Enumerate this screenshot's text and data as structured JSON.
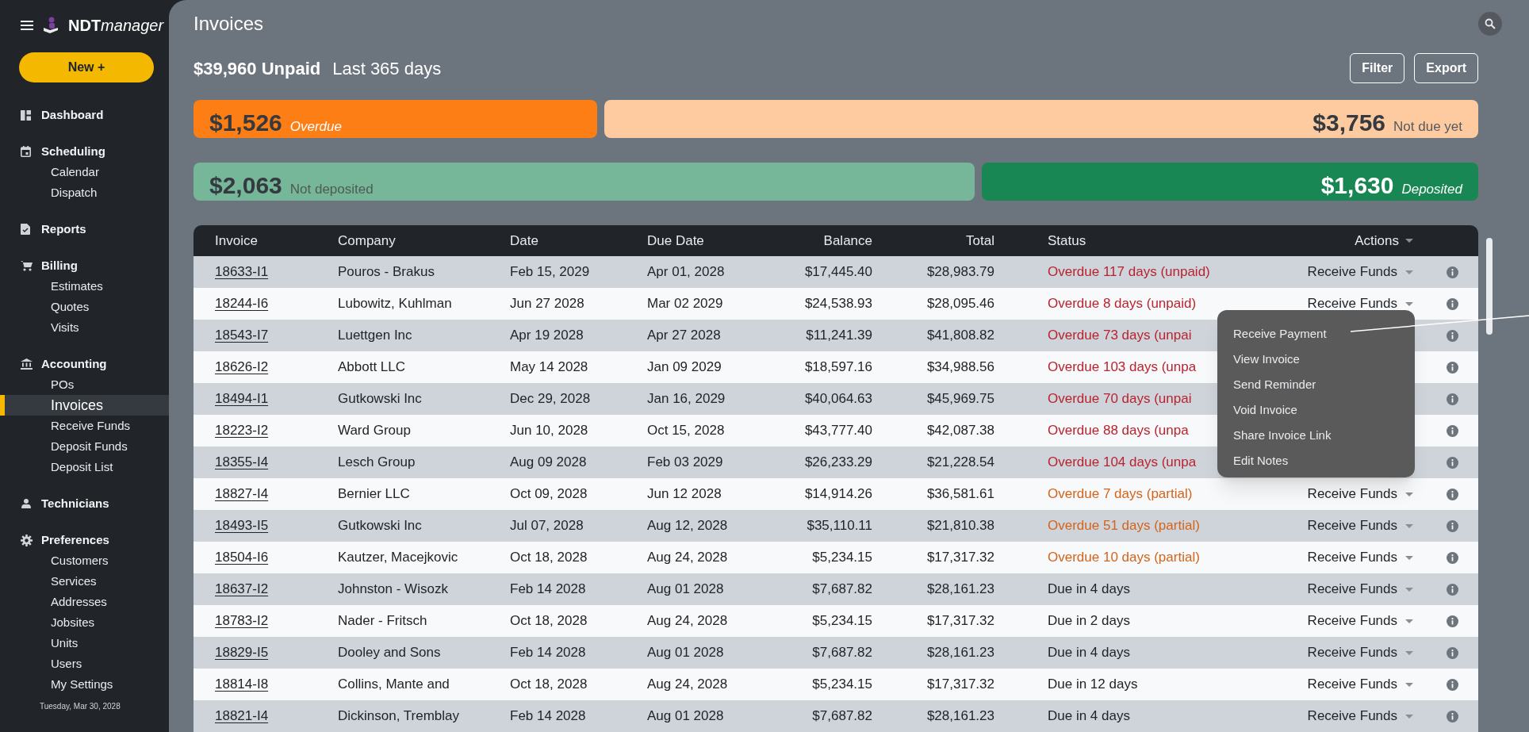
{
  "app": {
    "brand_bold": "NDT",
    "brand_rest": "manager",
    "new_button": "New +"
  },
  "sidebar": {
    "groups": [
      {
        "label": "Dashboard",
        "selected": false
      },
      {
        "label": "Scheduling",
        "selected": false,
        "children": [
          {
            "label": "Calendar",
            "selected": false
          },
          {
            "label": "Dispatch",
            "selected": false
          }
        ]
      },
      {
        "label": "Reports",
        "selected": false
      },
      {
        "label": "Billing",
        "selected": false,
        "children": [
          {
            "label": "Estimates",
            "selected": false
          },
          {
            "label": "Quotes",
            "selected": false
          },
          {
            "label": "Visits",
            "selected": false
          }
        ]
      },
      {
        "label": "Accounting",
        "selected": false,
        "children": [
          {
            "label": "POs",
            "selected": false
          },
          {
            "label": "Invoices",
            "selected": true
          },
          {
            "label": "Receive Funds",
            "selected": false
          },
          {
            "label": "Deposit Funds",
            "selected": false
          },
          {
            "label": "Deposit List",
            "selected": false
          }
        ]
      },
      {
        "label": "Technicians",
        "selected": false
      },
      {
        "label": "Preferences",
        "selected": false,
        "children": [
          {
            "label": "Customers",
            "selected": false
          },
          {
            "label": "Services",
            "selected": false
          },
          {
            "label": "Addresses",
            "selected": false
          },
          {
            "label": "Jobsites",
            "selected": false
          },
          {
            "label": "Units",
            "selected": false
          },
          {
            "label": "Users",
            "selected": false
          },
          {
            "label": "My Settings",
            "selected": false
          }
        ]
      }
    ],
    "date": "Tuesday, Mar 30, 2028"
  },
  "page": {
    "title": "Invoices",
    "unpaid": "$39,960 Unpaid",
    "period": "Last 365 days",
    "buttons": [
      "Filter",
      "Export"
    ]
  },
  "summary": [
    [
      {
        "kind": "overdue",
        "amount": "$1,526",
        "label": "Overdue"
      },
      {
        "kind": "notdue",
        "amount": "$3,756",
        "label": "Not due yet"
      }
    ],
    [
      {
        "kind": "notdeposited",
        "amount": "$2,063",
        "label": "Not deposited"
      },
      {
        "kind": "deposited",
        "amount": "$1,630",
        "label": "Deposited"
      }
    ]
  ],
  "table": {
    "columns": [
      "Invoice",
      "Company",
      "Date",
      "Due Date",
      "Balance",
      "Total",
      "Status",
      "Actions"
    ],
    "rows": [
      {
        "invoice": "18633-I1",
        "company": "Pouros - Brakus",
        "date": "Feb 15, 2029",
        "due": "Apr 01, 2028",
        "balance": "$17,445.40",
        "total": "$28,983.79",
        "status": "Overdue 117 days (unpaid)",
        "kind": "unpaid",
        "action": "Receive Funds"
      },
      {
        "invoice": "18244-I6",
        "company": "Lubowitz, Kuhlman",
        "date": "Jun 27 2028",
        "due": "Mar 02 2029",
        "balance": "$24,538.93",
        "total": "$28,095.46",
        "status": "Overdue 8 days (unpaid)",
        "kind": "unpaid",
        "action": "Receive Funds"
      },
      {
        "invoice": "18543-I7",
        "company": "Luettgen Inc",
        "date": "Apr 19 2028",
        "due": "Apr 27 2028",
        "balance": "$11,241.39",
        "total": "$41,808.82",
        "status": "Overdue 73 days (unpai",
        "kind": "unpaid"
      },
      {
        "invoice": "18626-I2",
        "company": "Abbott LLC",
        "date": "May 14 2028",
        "due": "Jan 09 2029",
        "balance": "$18,597.16",
        "total": "$34,988.56",
        "status": "Overdue 103 days (unpa",
        "kind": "unpaid"
      },
      {
        "invoice": "18494-I1",
        "company": "Gutkowski Inc",
        "date": "Dec 29, 2028",
        "due": "Jan 16, 2029",
        "balance": "$40,064.63",
        "total": "$45,969.75",
        "status": "Overdue 70 days (unpai",
        "kind": "unpaid"
      },
      {
        "invoice": "18223-I2",
        "company": "Ward Group",
        "date": "Jun 10, 2028",
        "due": "Oct 15, 2028",
        "balance": "$43,777.40",
        "total": "$42,087.38",
        "status": "Overdue 88 days (unpa",
        "kind": "unpaid"
      },
      {
        "invoice": "18355-I4",
        "company": "Lesch Group",
        "date": "Aug 09 2028",
        "due": "Feb 03 2029",
        "balance": "$26,233.29",
        "total": "$21,228.54",
        "status": "Overdue 104 days (unpa",
        "kind": "unpaid"
      },
      {
        "invoice": "18827-I4",
        "company": "Bernier LLC",
        "date": "Oct 09, 2028",
        "due": "Jun 12 2028",
        "balance": "$14,914.26",
        "total": "$36,581.61",
        "status": "Overdue 7 days (partial)",
        "kind": "partial",
        "action": "Receive Funds"
      },
      {
        "invoice": "18493-I5",
        "company": "Gutkowski Inc",
        "date": "Jul 07, 2028",
        "due": "Aug 12, 2028",
        "balance": "$35,110.11",
        "total": "$21,810.38",
        "status": "Overdue 51 days (partial)",
        "kind": "partial",
        "action": "Receive Funds"
      },
      {
        "invoice": "18504-I6",
        "company": "Kautzer, Macejkovic",
        "date": "Oct 18, 2028",
        "due": "Aug 24, 2028",
        "balance": "$5,234.15",
        "total": "$17,317.32",
        "status": "Overdue 10 days (partial)",
        "kind": "partial",
        "action": "Receive Funds"
      },
      {
        "invoice": "18637-I2",
        "company": "Johnston - Wisozk",
        "date": "Feb 14 2028",
        "due": "Aug 01 2028",
        "balance": "$7,687.82",
        "total": "$28,161.23",
        "status": "Due in 4 days",
        "kind": "due",
        "action": "Receive Funds"
      },
      {
        "invoice": "18783-I2",
        "company": "Nader - Fritsch",
        "date": "Oct 18, 2028",
        "due": "Aug 24, 2028",
        "balance": "$5,234.15",
        "total": "$17,317.32",
        "status": "Due in 2 days",
        "kind": "due",
        "action": "Receive Funds"
      },
      {
        "invoice": "18829-I5",
        "company": "Dooley and Sons",
        "date": "Feb 14 2028",
        "due": "Aug 01 2028",
        "balance": "$7,687.82",
        "total": "$28,161.23",
        "status": "Due in 4 days",
        "kind": "due",
        "action": "Receive Funds"
      },
      {
        "invoice": "18814-I8",
        "company": "Collins, Mante and",
        "date": "Oct 18, 2028",
        "due": "Aug 24, 2028",
        "balance": "$5,234.15",
        "total": "$17,317.32",
        "status": "Due in 12 days",
        "kind": "due",
        "action": "Receive Funds"
      },
      {
        "invoice": "18821-I4",
        "company": "Dickinson, Tremblay",
        "date": "Feb 14 2028",
        "due": "Aug 01 2028",
        "balance": "$7,687.82",
        "total": "$28,161.23",
        "status": "Due in 4 days",
        "kind": "due",
        "action": "Receive Funds"
      }
    ]
  },
  "menu": {
    "items": [
      "Receive Payment",
      "View Invoice",
      "Send Reminder",
      "Void Invoice",
      "Share Invoice Link",
      "Edit Notes"
    ]
  }
}
